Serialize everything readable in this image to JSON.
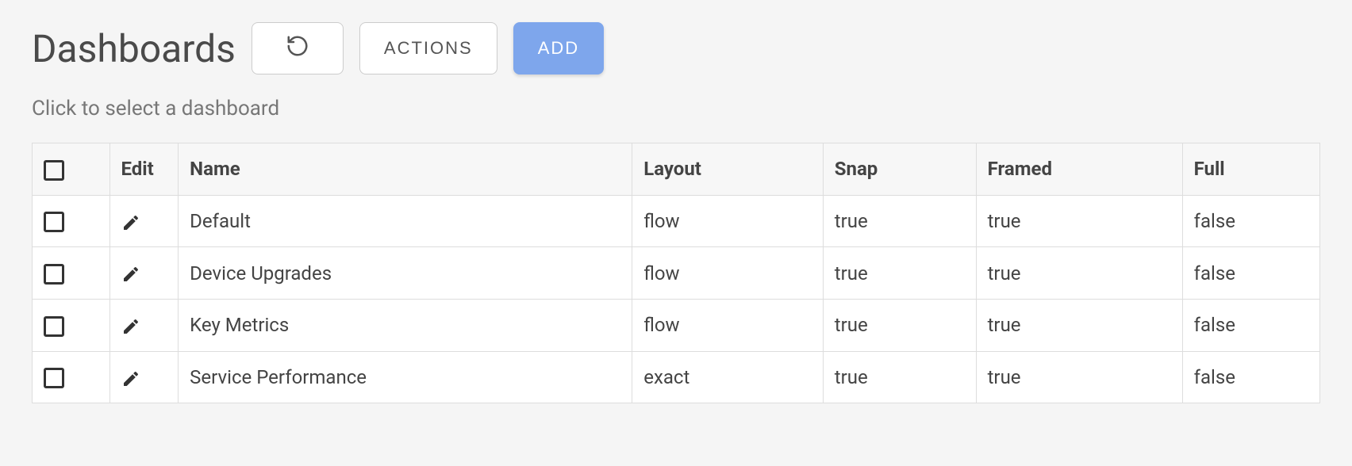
{
  "header": {
    "title": "Dashboards",
    "actions_label": "Actions",
    "add_label": "Add"
  },
  "subtitle": "Click to select a dashboard",
  "table": {
    "columns": {
      "edit": "Edit",
      "name": "Name",
      "layout": "Layout",
      "snap": "Snap",
      "framed": "Framed",
      "full": "Full"
    },
    "rows": [
      {
        "name": "Default",
        "layout": "flow",
        "snap": "true",
        "framed": "true",
        "full": "false"
      },
      {
        "name": "Device Upgrades",
        "layout": "flow",
        "snap": "true",
        "framed": "true",
        "full": "false"
      },
      {
        "name": "Key Metrics",
        "layout": "flow",
        "snap": "true",
        "framed": "true",
        "full": "false"
      },
      {
        "name": "Service Performance",
        "layout": "exact",
        "snap": "true",
        "framed": "true",
        "full": "false"
      }
    ]
  }
}
